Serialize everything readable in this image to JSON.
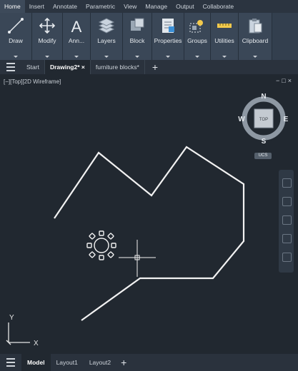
{
  "ribbon_tabs": [
    "Home",
    "Insert",
    "Annotate",
    "Parametric",
    "View",
    "Manage",
    "Output",
    "Collaborate"
  ],
  "ribbon_panels": [
    {
      "label": "Draw",
      "icon": "line-icon"
    },
    {
      "label": "Modify",
      "icon": "move-icon"
    },
    {
      "label": "Ann...",
      "icon": "text-icon"
    },
    {
      "label": "Layers",
      "icon": "layers-icon"
    },
    {
      "label": "Block",
      "icon": "block-icon"
    },
    {
      "label": "Properties",
      "icon": "properties-icon"
    },
    {
      "label": "Groups",
      "icon": "groups-icon"
    },
    {
      "label": "Utilities",
      "icon": "measure-icon"
    },
    {
      "label": "Clipboard",
      "icon": "clipboard-icon"
    }
  ],
  "document_tabs": [
    {
      "label": "Start",
      "active": false
    },
    {
      "label": "Drawing2*",
      "active": true
    },
    {
      "label": "furniture blocks*",
      "active": false
    }
  ],
  "viewport": {
    "label": "[−][Top][2D Wireframe]",
    "controls": "−□×",
    "viewcube": {
      "north": "N",
      "south": "S",
      "east": "E",
      "west": "W",
      "face": "TOP"
    },
    "ucs_label": "UCS",
    "axis_x": "X",
    "axis_y": "Y"
  },
  "layout_tabs": [
    {
      "label": "Model",
      "active": true
    },
    {
      "label": "Layout1",
      "active": false
    },
    {
      "label": "Layout2",
      "active": false
    }
  ],
  "colors": {
    "background": "#212830",
    "ribbon": "#333f4e",
    "geometry": "#f2f2f2"
  }
}
